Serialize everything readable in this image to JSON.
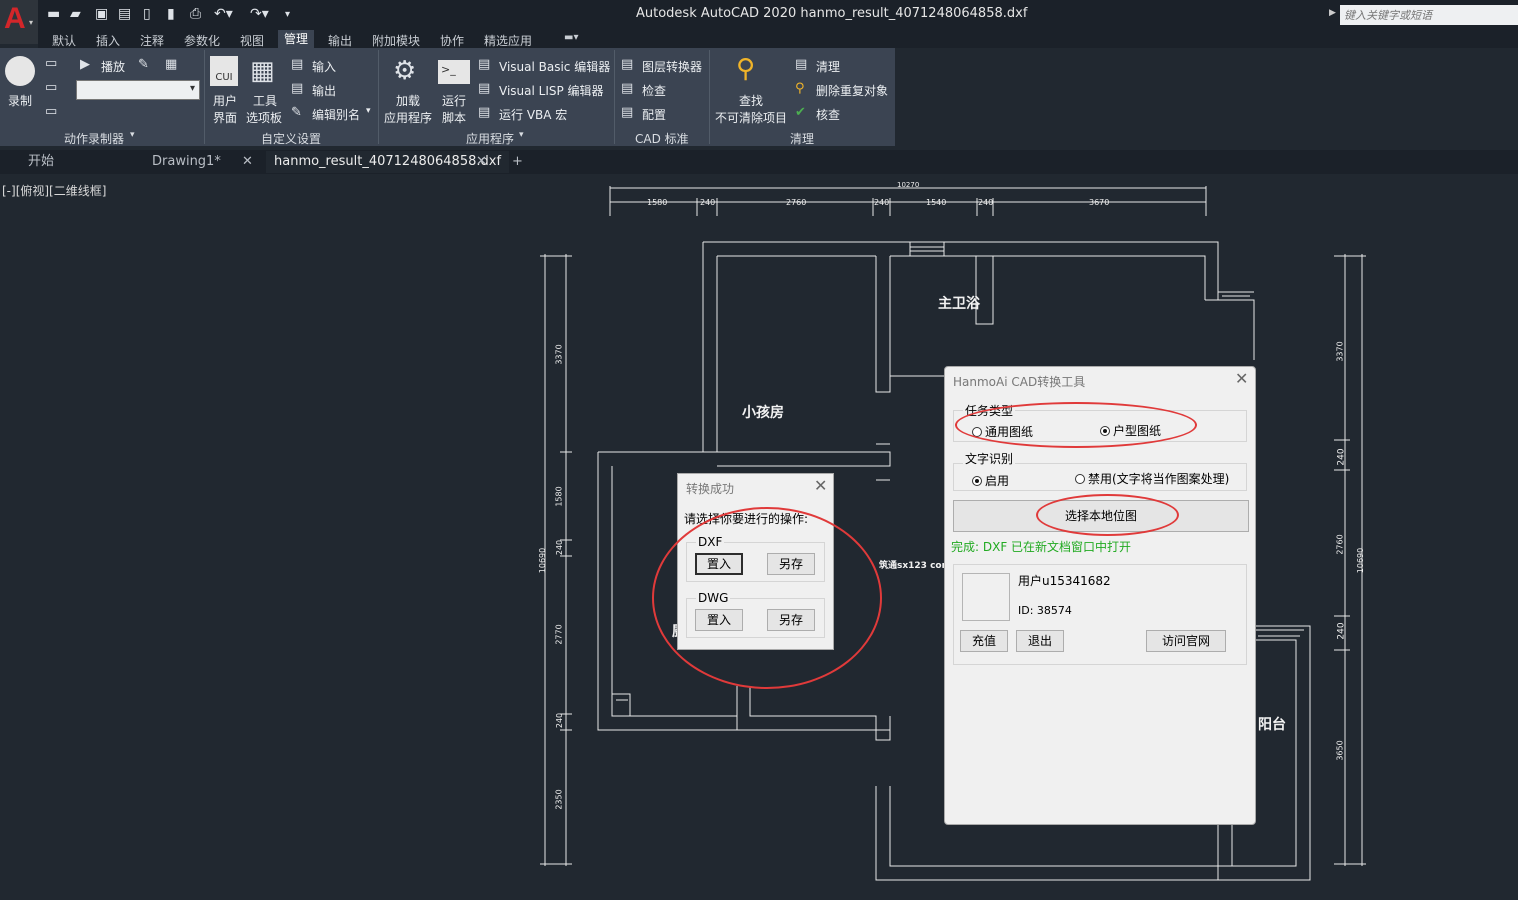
{
  "window": {
    "title": "Autodesk AutoCAD 2020    hanmo_result_4071248064858.dxf",
    "search_placeholder": "键入关键字或短语",
    "logo": "A"
  },
  "quick_access": [
    "new-icon",
    "open-icon",
    "save-icon",
    "saveas-icon",
    "plot-preview-icon",
    "publish-icon",
    "print-icon",
    "undo-icon",
    "redo-icon",
    "customize-icon"
  ],
  "menu": [
    "默认",
    "插入",
    "注释",
    "参数化",
    "视图",
    "管理",
    "输出",
    "附加模块",
    "协作",
    "精选应用"
  ],
  "menu_active_index": 5,
  "ribbon": {
    "action_recorder": {
      "record": "录制",
      "play": "播放",
      "label": "动作录制器"
    },
    "customize": {
      "cui": "CUI",
      "user_interface_1": "用户",
      "user_interface_2": "界面",
      "tools_1": "工具",
      "tools_2": "选项板",
      "import": "输入",
      "export": "输出",
      "edit_alias": "编辑别名",
      "label": "自定义设置"
    },
    "applications": {
      "load_1": "加载",
      "load_2": "应用程序",
      "run_1": "运行",
      "run_2": "脚本",
      "vb": "Visual Basic 编辑器",
      "lisp": "Visual LISP 编辑器",
      "vba": "运行 VBA 宏",
      "label": "应用程序"
    },
    "cad_standards": {
      "layer_translator": "图层转换器",
      "check": "检查",
      "configure": "配置",
      "label": "CAD 标准"
    },
    "cleanup": {
      "find_1": "查找",
      "find_2": "不可清除项目",
      "purge": "清理",
      "overkill": "删除重复对象",
      "audit": "核查",
      "label": "清理"
    }
  },
  "doc_tabs": [
    "开始",
    "Drawing1*",
    "hanmo_result_4071248064858.dxf"
  ],
  "view_label": "[-][俯视][二维线框]",
  "drawing": {
    "dims_top": [
      "10270",
      "1580",
      "240",
      "2760",
      "240",
      "1540",
      "240",
      "3670"
    ],
    "dims_left": [
      "3370",
      "1580",
      "240",
      "2770",
      "240",
      "2350",
      "10690"
    ],
    "dims_right": [
      "3370",
      "240",
      "2760",
      "240",
      "3650",
      "10690"
    ],
    "rooms": [
      "主卫浴",
      "小孩房",
      "阳台",
      "厨"
    ],
    "watermark": "筑通sx123 com"
  },
  "dialog_convert": {
    "title": "转换成功",
    "prompt": "请选择你要进行的操作:",
    "dxf_group": "DXF",
    "dwg_group": "DWG",
    "insert": "置入",
    "save_as": "另存"
  },
  "dialog_tool": {
    "title": "HanmoAi CAD转换工具",
    "task_group": "任务类型",
    "task_general": "通用图纸",
    "task_floorplan": "户型图纸",
    "task_selected": "户型图纸",
    "ocr_group": "文字识别",
    "ocr_on": "启用",
    "ocr_off": "禁用(文字将当作图案处理)",
    "ocr_selected": "启用",
    "select_button": "选择本地位图",
    "status": "完成: DXF 已在新文档窗口中打开",
    "user": "用户u15341682",
    "user_id": "ID: 38574",
    "recharge": "充值",
    "logout": "退出",
    "website": "访问官网"
  },
  "colors": {
    "annotation": "#e03a3a",
    "status": "#22aa22",
    "canvas": "#212830",
    "ribbon": "#3b4452"
  }
}
